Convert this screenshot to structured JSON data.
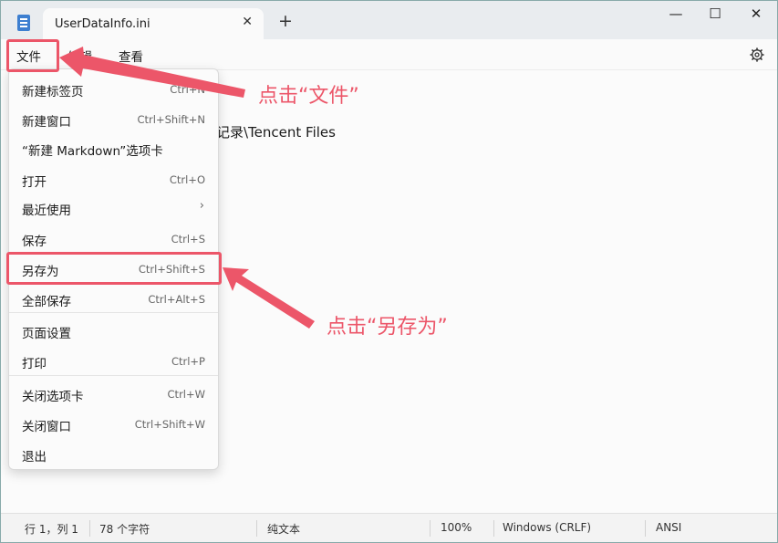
{
  "window": {
    "tab_title": "UserDataInfo.ini",
    "new_tab_symbol": "+",
    "close_tab_symbol": "✕",
    "minimize_symbol": "—",
    "maximize_symbol": "☐",
    "close_symbol": "✕"
  },
  "menubar": {
    "items": [
      "文件",
      "编辑",
      "查看"
    ]
  },
  "editor": {
    "visible_text": "记录\\Tencent Files"
  },
  "file_menu": {
    "items": [
      {
        "label": "新建标签页",
        "shortcut": "Ctrl+N"
      },
      {
        "label": "新建窗口",
        "shortcut": "Ctrl+Shift+N"
      },
      {
        "label": "“新建 Markdown”选项卡",
        "shortcut": ""
      },
      {
        "label": "打开",
        "shortcut": "Ctrl+O"
      },
      {
        "label": "最近使用",
        "shortcut": "",
        "submenu_symbol": "›"
      },
      {
        "label": "保存",
        "shortcut": "Ctrl+S"
      },
      {
        "label": "另存为",
        "shortcut": "Ctrl+Shift+S"
      },
      {
        "label": "全部保存",
        "shortcut": "Ctrl+Alt+S"
      },
      {
        "label": "页面设置",
        "shortcut": ""
      },
      {
        "label": "打印",
        "shortcut": "Ctrl+P"
      },
      {
        "label": "关闭选项卡",
        "shortcut": "Ctrl+W"
      },
      {
        "label": "关闭窗口",
        "shortcut": "Ctrl+Shift+W"
      },
      {
        "label": "退出",
        "shortcut": ""
      }
    ]
  },
  "statusbar": {
    "position": "行 1，列 1",
    "char_count": "78 个字符",
    "format": "纯文本",
    "zoom": "100%",
    "line_ending": "Windows (CRLF)",
    "encoding": "ANSI"
  },
  "annotations": {
    "click_file": "点击“文件”",
    "click_save_as": "点击“另存为”",
    "accent_color": "#ec5669"
  }
}
